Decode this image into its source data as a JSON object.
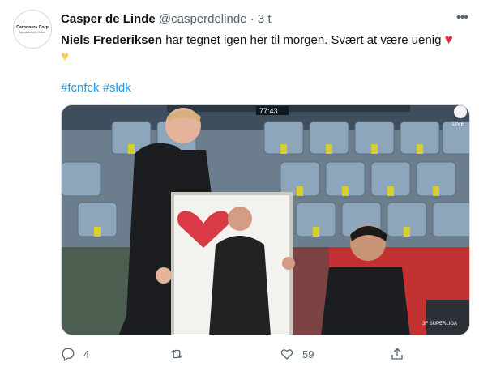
{
  "author": {
    "name": "Casper de Linde",
    "handle": "@casperdelinde",
    "separator": "·",
    "time": "3 t",
    "avatar_brand": "Carbonera Corp",
    "avatar_sub": "Specialized in Grillen"
  },
  "tweet": {
    "mention": "Niels Frederiksen",
    "text": " har tegnet igen her til morgen. Svært at være uenig ",
    "emoji_1": "♥",
    "emoji_2": "♥",
    "hashtags": [
      "#fcnfck",
      "#sldk"
    ]
  },
  "media": {
    "clock": "77:43",
    "live_label": "LIVE",
    "league_label": "3F SUPERLIGA",
    "scene": "football-stadium-coach-holding-drawing-photo"
  },
  "actions": {
    "reply_count": "4",
    "retweet_count": "",
    "like_count": "59"
  },
  "icons": {
    "more": "more-horizontal-icon",
    "reply": "reply-icon",
    "retweet": "retweet-icon",
    "like": "heart-icon",
    "share": "share-icon"
  },
  "colors": {
    "link": "#1d9bf0",
    "muted": "#536471",
    "heart_red": "#dd2e44",
    "heart_yellow": "#fdcb58"
  }
}
